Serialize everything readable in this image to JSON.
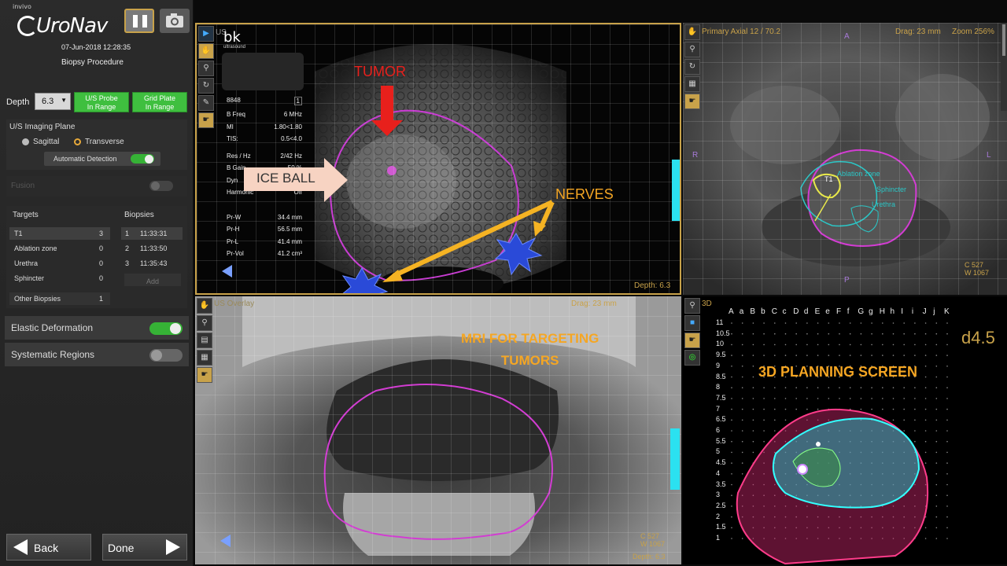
{
  "app": {
    "brand_small": "invivo",
    "name": "UroNav",
    "datetime": "07-Jun-2018 12:28:35",
    "procedure": "Biopsy Procedure"
  },
  "depth": {
    "label": "Depth",
    "value": "6.3"
  },
  "status": {
    "probe": "U/S Probe\nIn Range",
    "grid": "Grid Plate\nIn Range"
  },
  "imaging": {
    "title": "U/S Imaging Plane",
    "sagittal": "Sagittal",
    "transverse": "Transverse",
    "auto_detect": "Automatic Detection",
    "auto_detect_on": true
  },
  "fusion_label": "Fusion",
  "targets": {
    "header": "Targets",
    "items": [
      {
        "name": "T1",
        "count": "3"
      },
      {
        "name": "Ablation zone",
        "count": "0"
      },
      {
        "name": "Urethra",
        "count": "0"
      },
      {
        "name": "Sphincter",
        "count": "0"
      }
    ],
    "other_label": "Other Biopsies",
    "other_count": "1"
  },
  "biopsies": {
    "header": "Biopsies",
    "items": [
      {
        "n": "1",
        "time": "11:33:31"
      },
      {
        "n": "2",
        "time": "11:33:50"
      },
      {
        "n": "3",
        "time": "11:35:43"
      }
    ],
    "add_label": "Add"
  },
  "elastic": {
    "label": "Elastic Deformation",
    "on": true
  },
  "systematic": {
    "label": "Systematic Regions",
    "on": false
  },
  "footer": {
    "back": "Back",
    "done": "Done"
  },
  "us_panel": {
    "title": "US",
    "vendor": "bk",
    "vendor_sub": "ultrasound",
    "probe_id": "8848",
    "probe_num": "1",
    "params": [
      {
        "k": "B Freq",
        "v": "6 MHz"
      },
      {
        "k": "MI",
        "v": "1.80<1.80"
      },
      {
        "k": "TIS:",
        "v": "0.5<4.0"
      },
      {
        "k": "Res / Hz",
        "v": "2/42 Hz"
      },
      {
        "k": "B Gain",
        "v": "50 %"
      },
      {
        "k": "Dyn",
        "v": "6 dB"
      },
      {
        "k": "Harmonic",
        "v": "Off"
      },
      {
        "k": "Pr-W",
        "v": "34.4 mm"
      },
      {
        "k": "Pr-H",
        "v": "56.5 mm"
      },
      {
        "k": "Pr-L",
        "v": "41.4 mm"
      },
      {
        "k": "Pr-Vol",
        "v": "41.2 cm³"
      }
    ],
    "depth": "Depth: 6.3",
    "annotations": {
      "tumor": "TUMOR",
      "iceball": "ICE BALL",
      "nerves": "NERVES"
    }
  },
  "axial_panel": {
    "title": "Primary Axial 12 / 70.2",
    "drag": "Drag: 23 mm",
    "zoom": "Zoom 256%",
    "A": "A",
    "P": "P",
    "R": "R",
    "L": "L",
    "cw": "C 527\nW 1067",
    "t1": "T1",
    "lbl_ablation": "Ablation zone",
    "lbl_sphincter": "Sphincter",
    "lbl_urethra": "Urethra"
  },
  "overlay_panel": {
    "title": "US Overlay",
    "drag": "Drag: 23 mm",
    "annotation": "MRI FOR TARGETING\nTUMORS",
    "cw": "C 527\nW 1067",
    "depth": "Depth: 6.3"
  },
  "panel3d": {
    "title": "3D",
    "columns": [
      "A",
      "a",
      "B",
      "b",
      "C",
      "c",
      "D",
      "d",
      "E",
      "e",
      "F",
      "f",
      "G",
      "g",
      "H",
      "h",
      "I",
      "i",
      "J",
      "j",
      "K"
    ],
    "rows": [
      "11",
      "10.5",
      "10",
      "9.5",
      "9",
      "8.5",
      "8",
      "7.5",
      "7",
      "6.5",
      "6",
      "5.5",
      "5",
      "4.5",
      "4",
      "3.5",
      "3",
      "2.5",
      "2",
      "1.5",
      "1"
    ],
    "coord": "d4.5",
    "annotation": "3D PLANNING SCREEN"
  },
  "colors": {
    "accent": "#c8a24a",
    "green": "#3fbf3f",
    "cyan": "#2be1f0",
    "magenta": "#d23cd2",
    "orange": "#f5a623",
    "red": "#e8201c"
  }
}
